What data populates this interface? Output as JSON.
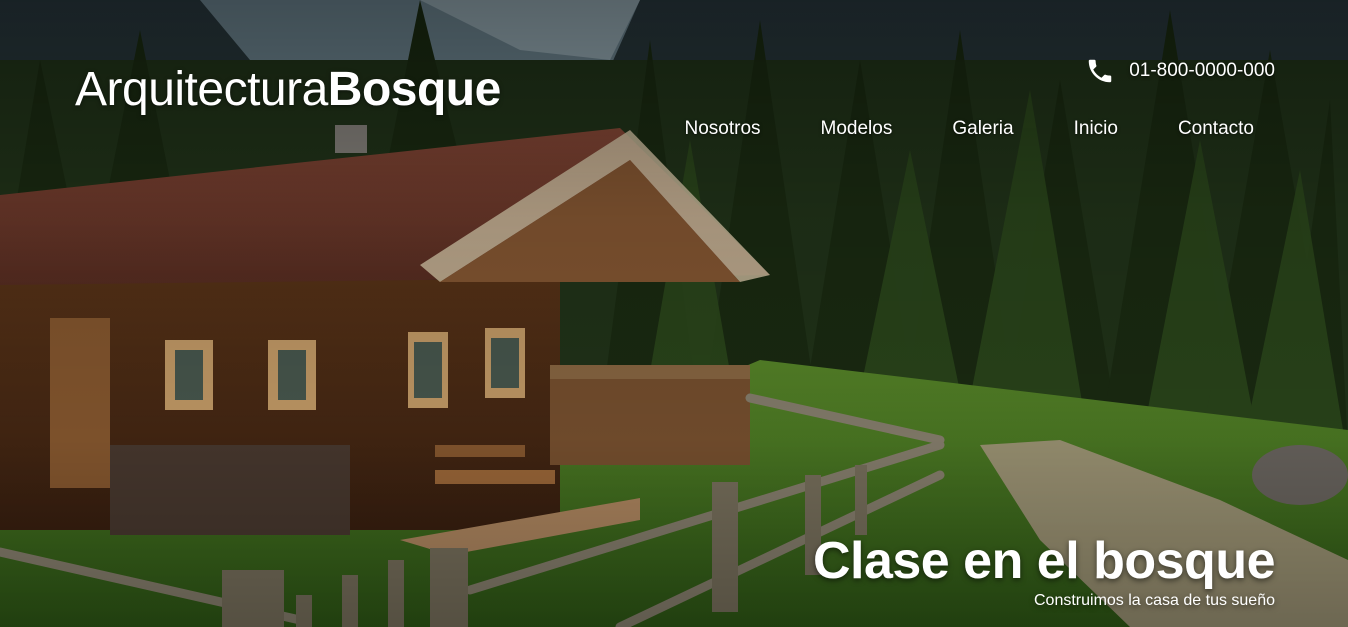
{
  "brand": {
    "light": "Arquitectura",
    "bold": "Bosque"
  },
  "contact": {
    "phone": "01-800-0000-000",
    "icon": "phone-icon"
  },
  "nav": {
    "items": [
      {
        "label": "Nosotros"
      },
      {
        "label": "Modelos"
      },
      {
        "label": "Galeria"
      },
      {
        "label": "Inicio"
      },
      {
        "label": "Contacto"
      }
    ]
  },
  "hero": {
    "title": "Clase en el bosque",
    "subtitle": "Construimos la casa de tus sueño"
  },
  "colors": {
    "text": "#ffffff",
    "forest": "#1e3314",
    "grass": "#4f8a22",
    "roof": "#7a4030",
    "wood": "#6b4022"
  }
}
